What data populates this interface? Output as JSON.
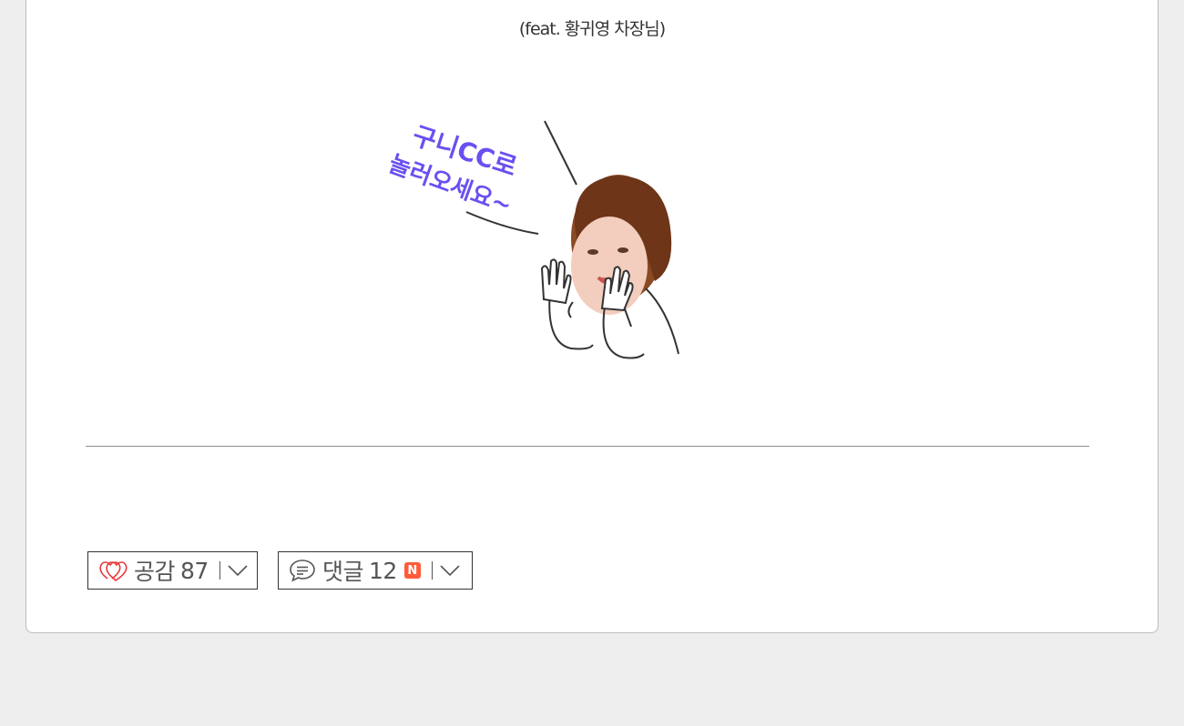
{
  "post": {
    "caption": "(feat. 황귀영 차장님)",
    "illustration": {
      "speech_text_line1": "구니CC로",
      "speech_text_line2": "놀러오세요~",
      "speech_color": "#6b4ff0"
    }
  },
  "actions": {
    "like": {
      "label": "공감",
      "count": "87",
      "icon": "heart-icon",
      "icon_color": "#e63a3a"
    },
    "comment": {
      "label": "댓글",
      "count": "12",
      "new_badge": "N",
      "badge_color": "#ff5b3a",
      "icon": "speech-bubble-icon"
    }
  }
}
